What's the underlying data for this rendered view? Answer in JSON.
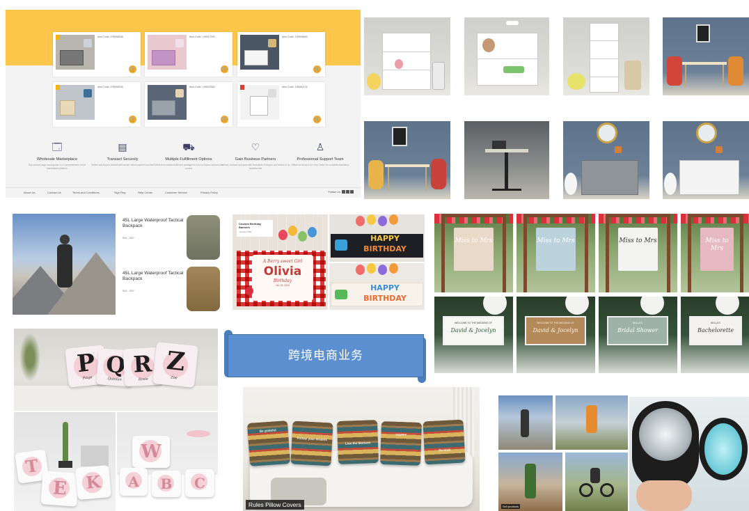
{
  "store": {
    "products": [
      {
        "code": "Item Code: 199938328"
      },
      {
        "code": "Item Code: 199917092"
      },
      {
        "code": "Item Code: 199939663"
      },
      {
        "code": "Item Code: 199939236"
      },
      {
        "code": "Item Code: 199937864"
      },
      {
        "code": "Item Code: 199940176"
      }
    ],
    "cart_glyph": "🛒",
    "features": [
      {
        "icon": "storefront-icon",
        "glyph": "🗔",
        "title": "Wholesale Marketplace",
        "desc": "Buy and sell large sized goods on a comprehensive online Marketplace platform"
      },
      {
        "icon": "register-icon",
        "glyph": "▤",
        "title": "Transact Securely",
        "desc": "Sellers and Buyers backed with secure online payment process"
      },
      {
        "icon": "truck-icon",
        "glyph": "⛟",
        "title": "Multiple Fulfillment Options",
        "desc": "Select from various fulfillment packages to ship to regions around your country"
      },
      {
        "icon": "handshake-icon",
        "glyph": "♡",
        "title": "Gain Business Partners",
        "desc": "Interact, transact and grow with thousands of Buyers and Sellers in its business talk"
      },
      {
        "icon": "support-agent-icon",
        "glyph": "♙",
        "title": "Professional Support Team",
        "desc": "Offline we fail and our Help Center for complete assistance"
      }
    ],
    "footer_links": [
      "About Us",
      "Contact Us",
      "Terms and Conditions",
      "Sign Reg",
      "Help Center",
      "Customer Service",
      "Privacy Policy"
    ],
    "follow_label": "Follow Us"
  },
  "backpack": {
    "items": [
      {
        "title": "45L Large Waterproof Tactical Backpack",
        "price": "$46 - $57"
      },
      {
        "title": "45L Large Waterproof Tactical Backpack",
        "price": "$46 - $57"
      }
    ]
  },
  "birthday": {
    "sign_title": "Custom Birthday Banners",
    "sign_sub": "Jewelery Mills",
    "script_line": "A Berry sweet Girl",
    "name": "Olivia",
    "sub_line": "Birthday",
    "date_line": "Jul. 18, 2024",
    "happy": "HAPPY",
    "birthday_word": "BIRTHDAY"
  },
  "wedding": {
    "backdrops": [
      {
        "text": "Miss to Mrs",
        "cloth": "#e9d9c9"
      },
      {
        "text": "Miss to Mrs",
        "cloth": "#bcd3dd"
      },
      {
        "text": "Miss to Mrs",
        "cloth": "#f4f4f2"
      },
      {
        "text": "Miss to Mrs",
        "cloth": "#e6b9c0"
      }
    ],
    "signs": [
      {
        "small": "Welcome to the wedding of",
        "name": "David & Jocelyn",
        "board": "#f6f6f2",
        "ink": "#2d5a36"
      },
      {
        "small": "Welcome to the wedding of",
        "name": "David & Jocelyn",
        "board": "#b58a5a",
        "ink": "#fff4e0"
      },
      {
        "small": "Bella's",
        "name": "Bridal Shower",
        "board": "#9fb2a9",
        "ink": "#ffffff"
      },
      {
        "small": "Bella's",
        "name": "Bachelorette",
        "board": "#f4f2ee",
        "ink": "#3a3a3a"
      }
    ]
  },
  "pillows": {
    "letters": [
      "P",
      "Q",
      "R",
      "Z"
    ],
    "names": [
      "Paige",
      "Quinlan",
      "Rosie",
      "Zoe"
    ],
    "bl_letters": [
      "T",
      "E",
      "K"
    ],
    "br_letters": [
      "W",
      "A",
      "B",
      "C"
    ]
  },
  "ribbon": {
    "text": "跨境电商业务"
  },
  "sofa": {
    "caption": "Rules Pillow Covers",
    "pillow_words": [
      "Be grateful",
      "Follow your dreams",
      "Live the Moment",
      "HAPPY",
      "Be kind"
    ]
  },
  "outdoor": {
    "caption": "Sell products"
  }
}
